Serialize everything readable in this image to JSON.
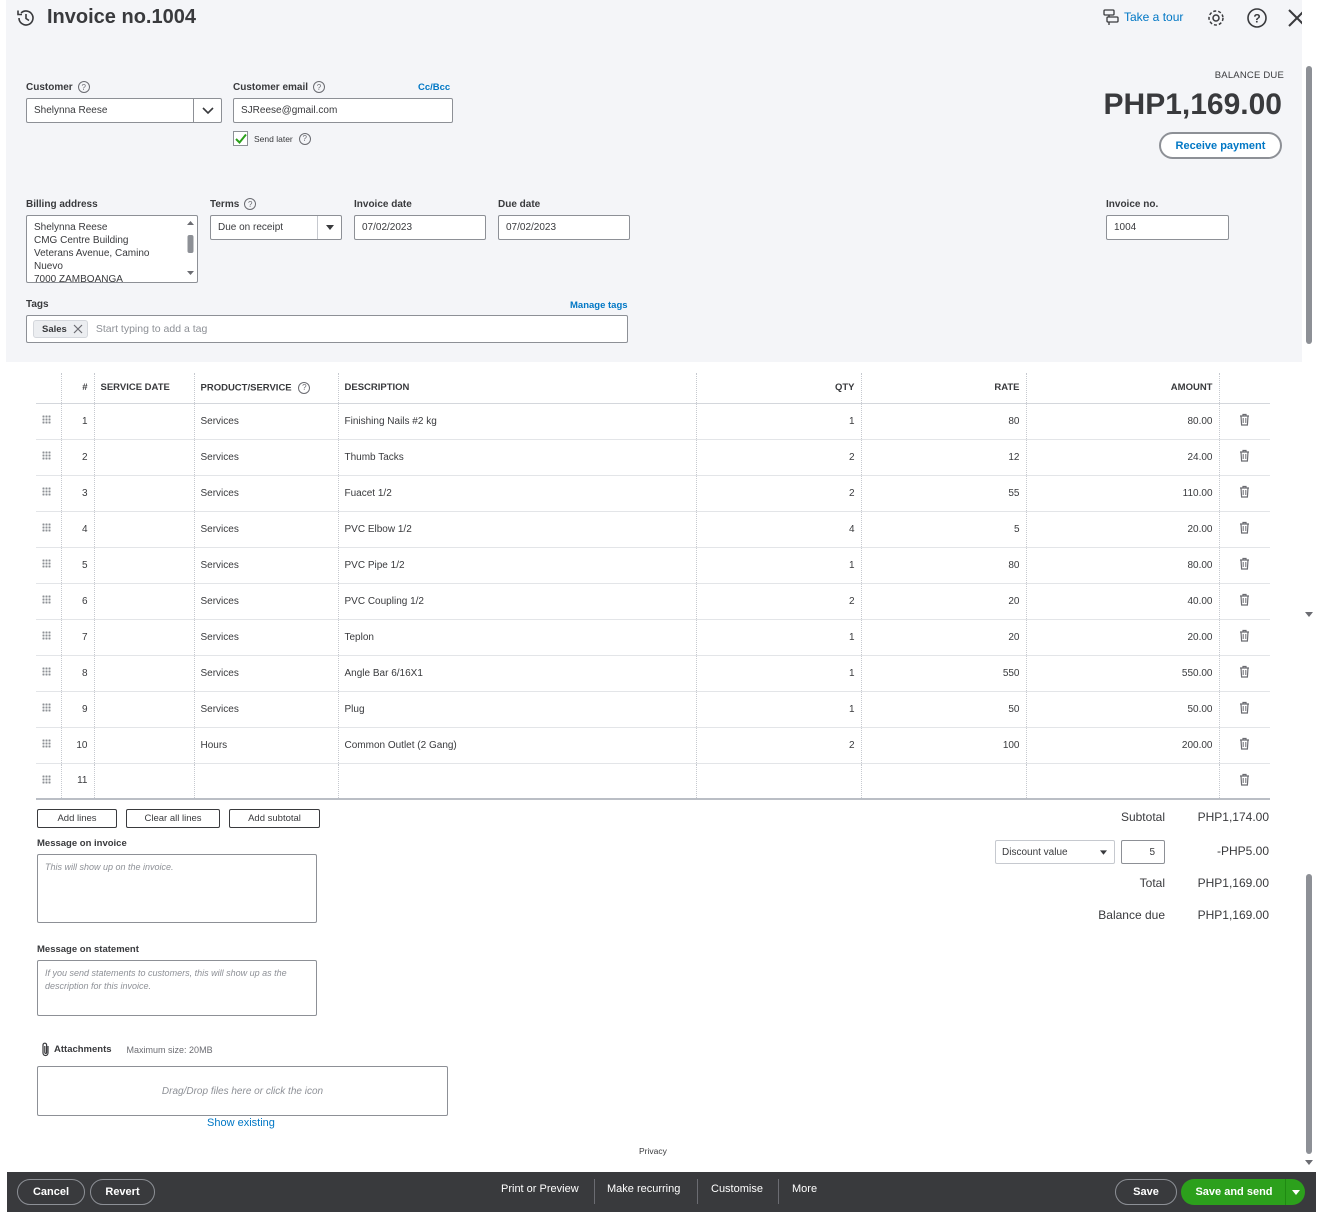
{
  "header": {
    "title": "Invoice no.1004",
    "take_tour": "Take a tour"
  },
  "customer": {
    "label": "Customer",
    "value": "Shelynna Reese"
  },
  "email": {
    "label": "Customer email",
    "value": "SJReese@gmail.com",
    "cc_bcc": "Cc/Bcc",
    "send_later": "Send later",
    "send_later_checked": true
  },
  "balance": {
    "label": "BALANCE DUE",
    "amount": "PHP1,169.00",
    "receive_payment": "Receive payment"
  },
  "billing": {
    "label": "Billing address",
    "lines": [
      "Shelynna Reese",
      "CMG Centre Building",
      "Veterans Avenue, Camino",
      "Nuevo",
      "7000 ZAMBOANGA"
    ]
  },
  "terms": {
    "label": "Terms",
    "value": "Due on receipt"
  },
  "invoice_date": {
    "label": "Invoice date",
    "value": "07/02/2023"
  },
  "due_date": {
    "label": "Due date",
    "value": "07/02/2023"
  },
  "invoice_no": {
    "label": "Invoice no.",
    "value": "1004"
  },
  "tags": {
    "label": "Tags",
    "manage": "Manage tags",
    "chips": [
      "Sales"
    ],
    "placeholder": "Start typing to add a tag"
  },
  "table": {
    "columns": [
      "#",
      "SERVICE DATE",
      "PRODUCT/SERVICE",
      "DESCRIPTION",
      "QTY",
      "RATE",
      "AMOUNT"
    ],
    "rows": [
      {
        "n": "1",
        "date": "",
        "product": "Services",
        "desc": "Finishing Nails #2 kg",
        "qty": "1",
        "rate": "80",
        "amount": "80.00"
      },
      {
        "n": "2",
        "date": "",
        "product": "Services",
        "desc": "Thumb Tacks",
        "qty": "2",
        "rate": "12",
        "amount": "24.00"
      },
      {
        "n": "3",
        "date": "",
        "product": "Services",
        "desc": "Fuacet 1/2",
        "qty": "2",
        "rate": "55",
        "amount": "110.00"
      },
      {
        "n": "4",
        "date": "",
        "product": "Services",
        "desc": "PVC Elbow 1/2",
        "qty": "4",
        "rate": "5",
        "amount": "20.00"
      },
      {
        "n": "5",
        "date": "",
        "product": "Services",
        "desc": "PVC Pipe 1/2",
        "qty": "1",
        "rate": "80",
        "amount": "80.00"
      },
      {
        "n": "6",
        "date": "",
        "product": "Services",
        "desc": "PVC Coupling 1/2",
        "qty": "2",
        "rate": "20",
        "amount": "40.00"
      },
      {
        "n": "7",
        "date": "",
        "product": "Services",
        "desc": "Teplon",
        "qty": "1",
        "rate": "20",
        "amount": "20.00"
      },
      {
        "n": "8",
        "date": "",
        "product": "Services",
        "desc": "Angle Bar 6/16X1",
        "qty": "1",
        "rate": "550",
        "amount": "550.00"
      },
      {
        "n": "9",
        "date": "",
        "product": "Services",
        "desc": "Plug",
        "qty": "1",
        "rate": "50",
        "amount": "50.00"
      },
      {
        "n": "10",
        "date": "",
        "product": "Hours",
        "desc": "Common Outlet (2 Gang)",
        "qty": "2",
        "rate": "100",
        "amount": "200.00"
      },
      {
        "n": "11",
        "date": "",
        "product": "",
        "desc": "",
        "qty": "",
        "rate": "",
        "amount": ""
      }
    ]
  },
  "actions": {
    "add_lines": "Add lines",
    "clear_all": "Clear all lines",
    "add_subtotal": "Add subtotal"
  },
  "totals": {
    "subtotal_label": "Subtotal",
    "subtotal": "PHP1,174.00",
    "discount_type": "Discount value",
    "discount_input": "5",
    "discount": "-PHP5.00",
    "total_label": "Total",
    "total": "PHP1,169.00",
    "balance_due_label": "Balance due",
    "balance_due": "PHP1,169.00"
  },
  "messages": {
    "invoice_label": "Message on invoice",
    "invoice_placeholder": "This will show up on the invoice.",
    "statement_label": "Message on statement",
    "statement_placeholder": "If you send statements to customers, this will show up as the description for this invoice."
  },
  "attachments": {
    "label": "Attachments",
    "max_size": "Maximum size: 20MB",
    "dropzone": "Drag/Drop files here or click the icon",
    "show_existing": "Show existing"
  },
  "privacy": "Privacy",
  "footer": {
    "cancel": "Cancel",
    "revert": "Revert",
    "print_preview": "Print or Preview",
    "make_recurring": "Make recurring",
    "customise": "Customise",
    "more": "More",
    "save": "Save",
    "save_and_send": "Save and send"
  },
  "colors": {
    "link": "#0077c5",
    "primary_green": "#2ca01c",
    "footer_bg": "#393a3d",
    "panel_bg": "#f4f5f8"
  }
}
